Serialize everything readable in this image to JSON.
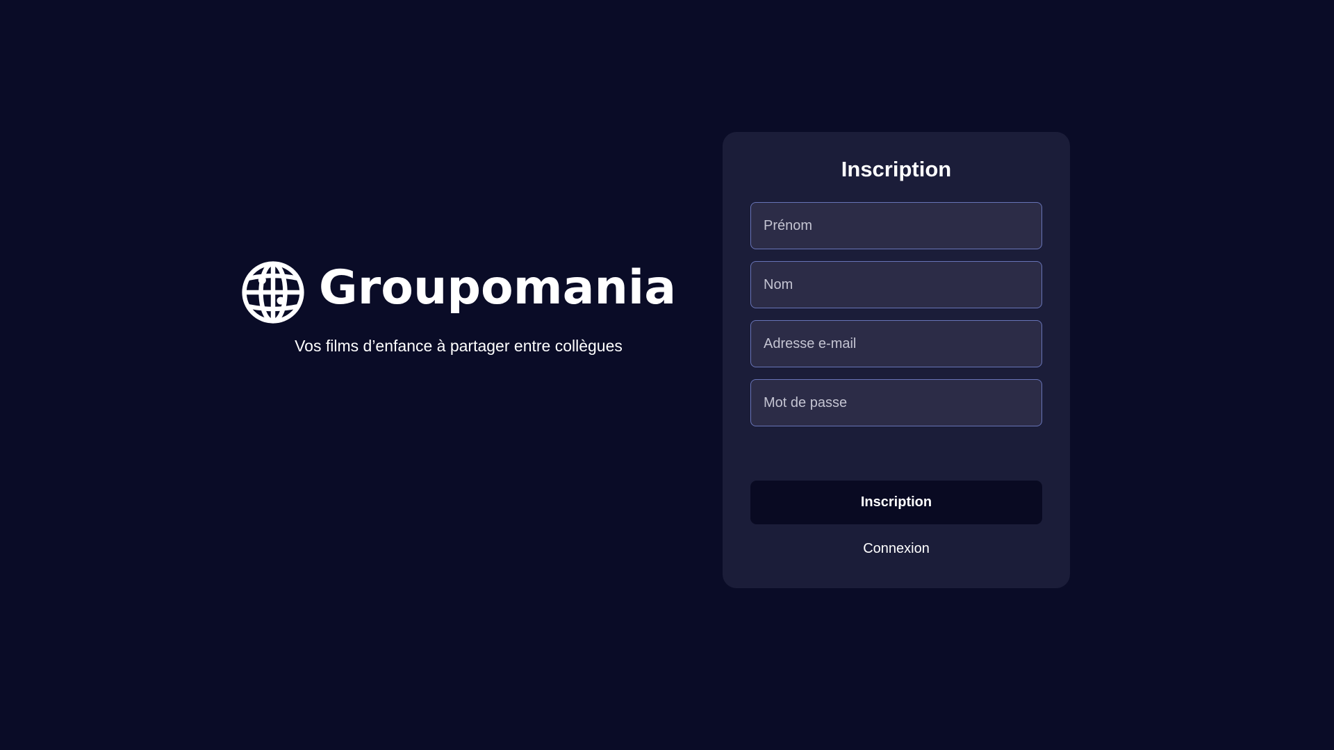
{
  "brand": {
    "name": "Groupomania",
    "tagline": "Vos films d’enfance à partager entre collègues",
    "icon": "globe-icon"
  },
  "signup_card": {
    "title": "Inscription",
    "fields": {
      "first_name_placeholder": "Prénom",
      "last_name_placeholder": "Nom",
      "email_placeholder": "Adresse e-mail",
      "password_placeholder": "Mot de passe"
    },
    "submit_label": "Inscription",
    "login_link_label": "Connexion"
  },
  "colors": {
    "background": "#0a0c27",
    "card": "#1b1d39",
    "field": "#2c2c47",
    "field_border": "#6874b8",
    "button": "#090a22",
    "text": "#ffffff"
  }
}
